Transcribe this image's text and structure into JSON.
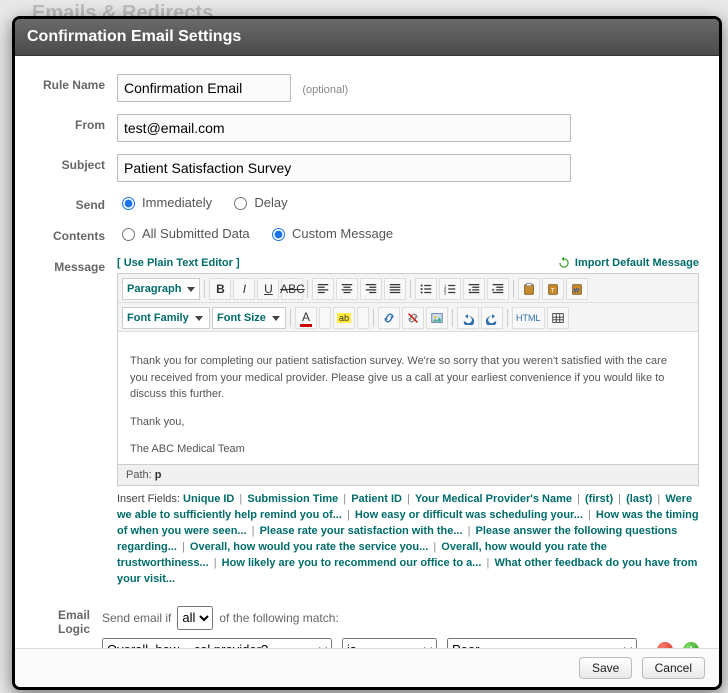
{
  "backdrop_title": "Emails & Redirects",
  "modal_title": "Confirmation Email Settings",
  "labels": {
    "rule_name": "Rule Name",
    "from": "From",
    "subject": "Subject",
    "send": "Send",
    "contents": "Contents",
    "message": "Message",
    "email_logic": "Email Logic"
  },
  "rule_name": {
    "value": "Confirmation Email",
    "optional": "(optional)"
  },
  "from": {
    "value": "test@email.com"
  },
  "subject": {
    "value": "Patient Satisfaction Survey"
  },
  "send": {
    "immediately": "Immediately",
    "delay": "Delay",
    "selected": "immediately"
  },
  "contents": {
    "all_data": "All Submitted Data",
    "custom": "Custom Message",
    "selected": "custom"
  },
  "message": {
    "plain_text_link": "[ Use Plain Text Editor ]",
    "import_default": "Import Default Message",
    "toolbar": {
      "paragraph": "Paragraph",
      "font_family": "Font Family",
      "font_size": "Font Size",
      "html_label": "HTML"
    },
    "body_p1": "Thank you for completing our patient satisfaction survey. We're so sorry that you weren't satisfied with the care you received from your medical provider. Please give us a call at your earliest convenience if you would like to discuss this further.",
    "body_p2": "Thank you,",
    "body_p3": "The ABC Medical Team",
    "path_label": "Path:",
    "path_value": "p"
  },
  "insert_fields": {
    "label": "Insert Fields:",
    "items": [
      "Unique ID",
      "Submission Time",
      "Patient ID",
      "Your Medical Provider's Name",
      "(first)",
      "(last)",
      "Were we able to sufficiently help remind you of...",
      "How easy or difficult was scheduling your...",
      "How was the timing of when you were seen...",
      "Please rate your satisfaction with the...",
      "Please answer the following questions regarding...",
      "Overall, how would you rate the service you...",
      "Overall, how would you rate the trustworthiness...",
      "How likely are you to recommend our office to a...",
      "What other feedback do you have from your visit..."
    ]
  },
  "logic": {
    "prefix": "Send email if",
    "match_scope": "all",
    "suffix": "of the following match:",
    "condition": {
      "field": "Overall, how ...cal provider?",
      "operator": "is",
      "value": "Poor"
    }
  },
  "footer": {
    "save": "Save",
    "cancel": "Cancel"
  }
}
